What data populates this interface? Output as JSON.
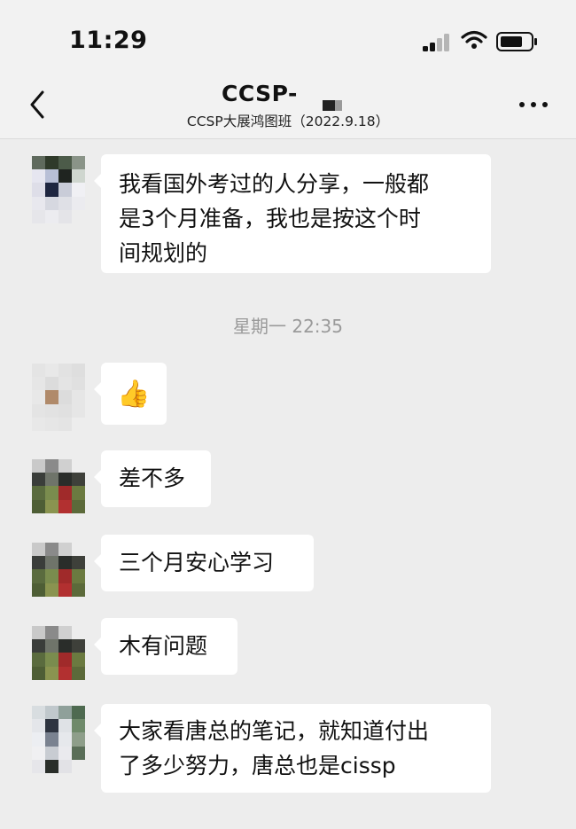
{
  "status": {
    "time": "11:29"
  },
  "header": {
    "title": "CCSP-",
    "subtitle": "CCSP大展鸿图班（2022.9.18）"
  },
  "timestamp": "星期一 22:35",
  "messages": [
    {
      "lines": [
        "我看国外考过的人分享，一般都",
        "是3个月准备，我也是按这个时",
        "间规划的"
      ]
    },
    {
      "text": "👍"
    },
    {
      "text": "差不多"
    },
    {
      "text": "三个月安心学习"
    },
    {
      "text": "木有问题"
    },
    {
      "lines": [
        "大家看唐总的笔记，就知道付出",
        "了多少努力，唐总也是cissp"
      ]
    }
  ],
  "icons": {
    "back": "chevron-left-icon",
    "more": "more-dots-icon",
    "signal": "cellular-signal-icon",
    "wifi": "wifi-icon",
    "battery": "battery-icon"
  }
}
